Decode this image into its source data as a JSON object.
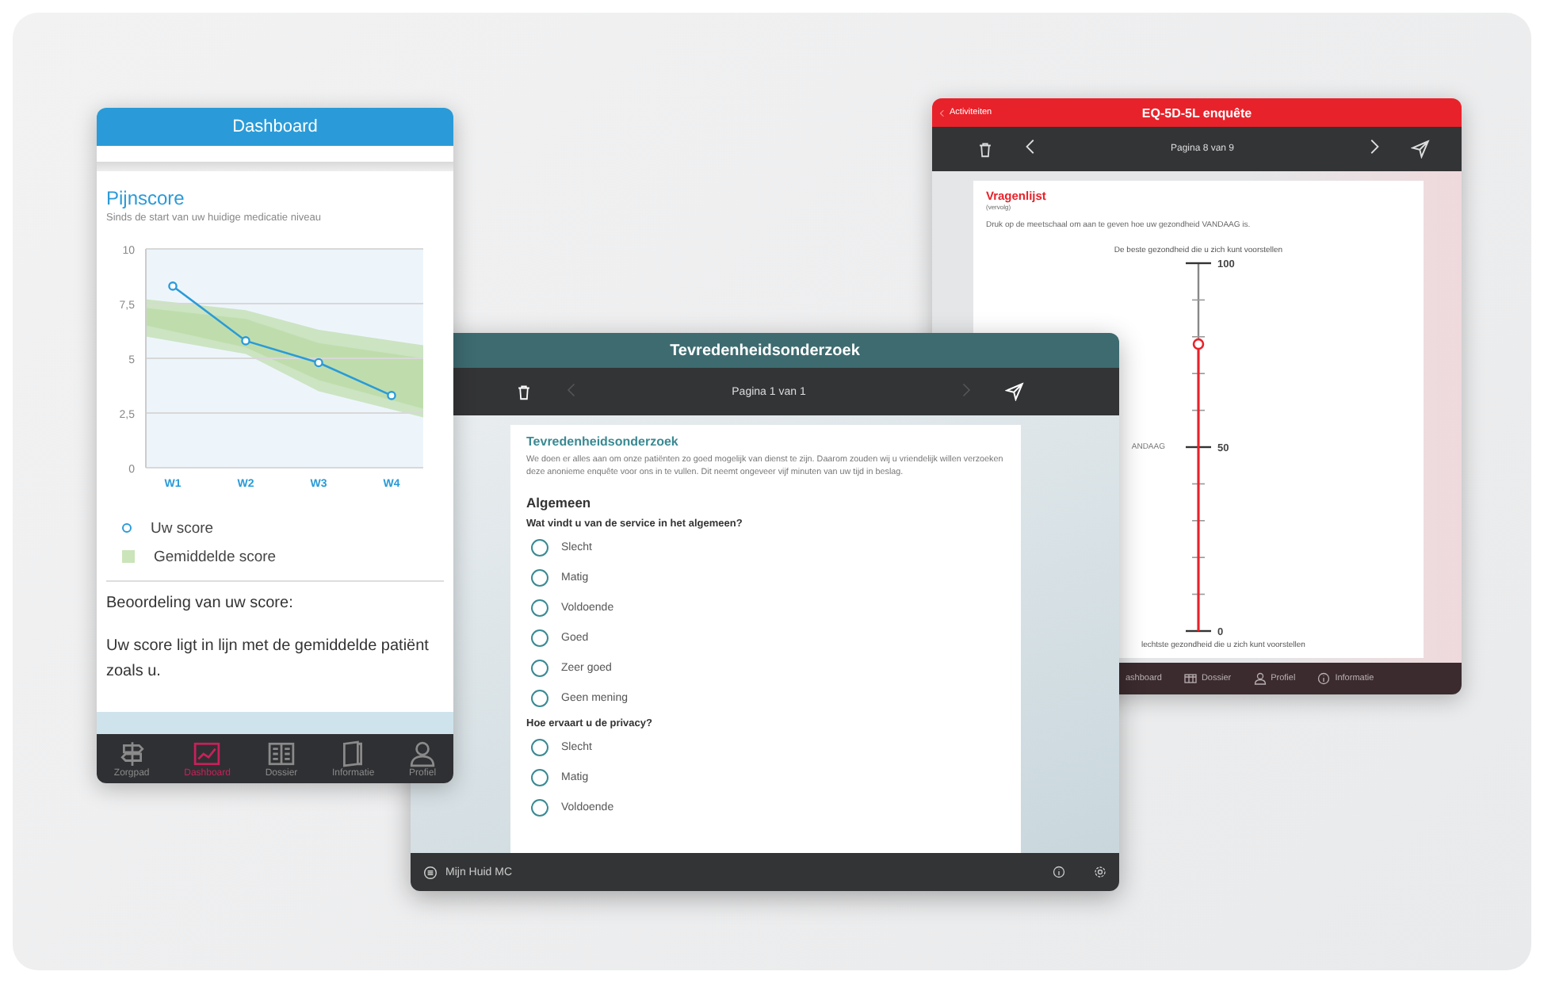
{
  "dashboard": {
    "title": "Dashboard",
    "card_title": "Pijnscore",
    "card_subtitle": "Sinds de start van uw huidige medicatie niveau",
    "chart_data": {
      "type": "line",
      "grid": true,
      "categories": [
        "W1",
        "W2",
        "W3",
        "W4"
      ],
      "ylim": [
        0,
        10
      ],
      "yticks": [
        0,
        {
          "value": 2.5,
          "label": "2,5"
        },
        5,
        {
          "value": 7.5,
          "label": "7,5"
        },
        10
      ],
      "series": [
        {
          "name": "Uw score",
          "color": "#2a9bd8",
          "marker": "circle",
          "values": [
            8.3,
            5.8,
            4.8,
            3.3
          ]
        }
      ]
    },
    "average_legend": "Gemiddelde score",
    "assessment_label": "Beoordeling van uw score:",
    "assessment_text": "Uw score ligt in lijn met de gemiddelde patiënt zoals u.",
    "tabs": [
      {
        "label": "Zorgpad",
        "selected": false
      },
      {
        "label": "Dashboard",
        "selected": true
      },
      {
        "label": "Dossier",
        "selected": false
      },
      {
        "label": "Informatie",
        "selected": false
      },
      {
        "label": "Profiel",
        "selected": false
      }
    ]
  },
  "eq": {
    "back": "Activiteiten",
    "title": "EQ-5D-5L enquête",
    "page": "Pagina 8 van 9",
    "prev_disabled": false,
    "next_disabled": false,
    "form_title": "Vragenlijst",
    "form_subtitle": "(vervolg)",
    "instruction": "Druk op de meetschaal om aan te geven hoe uw gezondheid VANDAAG is.",
    "top_label": "De beste gezondheid die u zich kunt voorstellen",
    "scale_labels": [
      "100",
      "50",
      "0"
    ],
    "side_text": "ANDAAG",
    "level": 0.78,
    "bottom_label": "lechtste gezondheid die u zich kunt voorstellen",
    "tabs": [
      "ashboard",
      "Dossier",
      "Profiel",
      "Informatie"
    ]
  },
  "survey": {
    "title": "Tevredenheidsonderzoek",
    "page": "Pagina 1 van 1",
    "prev_disabled": true,
    "next_disabled": true,
    "form_title": "Tevredenheidsonderzoek",
    "intro": "We doen er alles aan om onze patiënten zo goed mogelijk van dienst te zijn. Daarom zouden wij u vriendelijk willen verzoeken deze anonieme enquête voor ons in te vullen. Dit neemt ongeveer vijf minuten van uw tijd in beslag.",
    "section": "Algemeen",
    "questions": [
      {
        "text": "Wat vindt u van de service in het algemeen?",
        "options": [
          {
            "label": "Slecht",
            "selected": false
          },
          {
            "label": "Matig",
            "selected": false
          },
          {
            "label": "Voldoende",
            "selected": false
          },
          {
            "label": "Goed",
            "selected": false
          },
          {
            "label": "Zeer goed",
            "selected": false
          },
          {
            "label": "Geen mening",
            "selected": false
          }
        ]
      },
      {
        "text": "Hoe ervaart u de privacy?",
        "options": [
          {
            "label": "Slecht",
            "selected": false
          },
          {
            "label": "Matig",
            "selected": false
          },
          {
            "label": "Voldoende",
            "selected": false
          }
        ]
      }
    ],
    "footer": "Mijn Huid MC"
  }
}
